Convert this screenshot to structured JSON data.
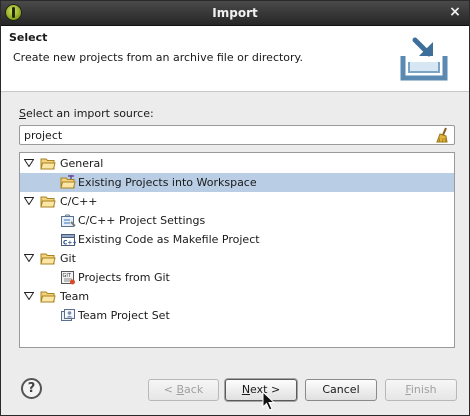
{
  "window": {
    "title": "Import",
    "close_glyph": "×"
  },
  "header": {
    "title": "Select",
    "description": "Create new projects from an archive file or directory.",
    "banner_icon": "import-tray-icon"
  },
  "source": {
    "label_mnemonic": "S",
    "label_rest": "elect an import source:",
    "filter_value": "project"
  },
  "tree": {
    "items": [
      {
        "label": "General",
        "icon": "folder-icon",
        "expanded": true
      },
      {
        "label": "Existing Projects into Workspace",
        "icon": "existing-projects-icon",
        "selected": true
      },
      {
        "label": "C/C++",
        "icon": "folder-icon",
        "expanded": true
      },
      {
        "label": "C/C++ Project Settings",
        "icon": "project-settings-icon"
      },
      {
        "label": "Existing Code as Makefile Project",
        "icon": "makefile-project-icon"
      },
      {
        "label": "Git",
        "icon": "folder-icon",
        "expanded": true
      },
      {
        "label": "Projects from Git",
        "icon": "git-repository-icon"
      },
      {
        "label": "Team",
        "icon": "folder-icon",
        "expanded": true
      },
      {
        "label": "Team Project Set",
        "icon": "team-project-set-icon"
      }
    ]
  },
  "buttons": {
    "help": "?",
    "back": "< Back",
    "back_mnemonic": "B",
    "next": "Next >",
    "next_mnemonic": "N",
    "cancel": "Cancel",
    "finish": "Finish",
    "finish_mnemonic": "F"
  },
  "colors": {
    "selection": "#b9cde5",
    "titlebar": "#333333",
    "folder": "#e8c15a"
  }
}
